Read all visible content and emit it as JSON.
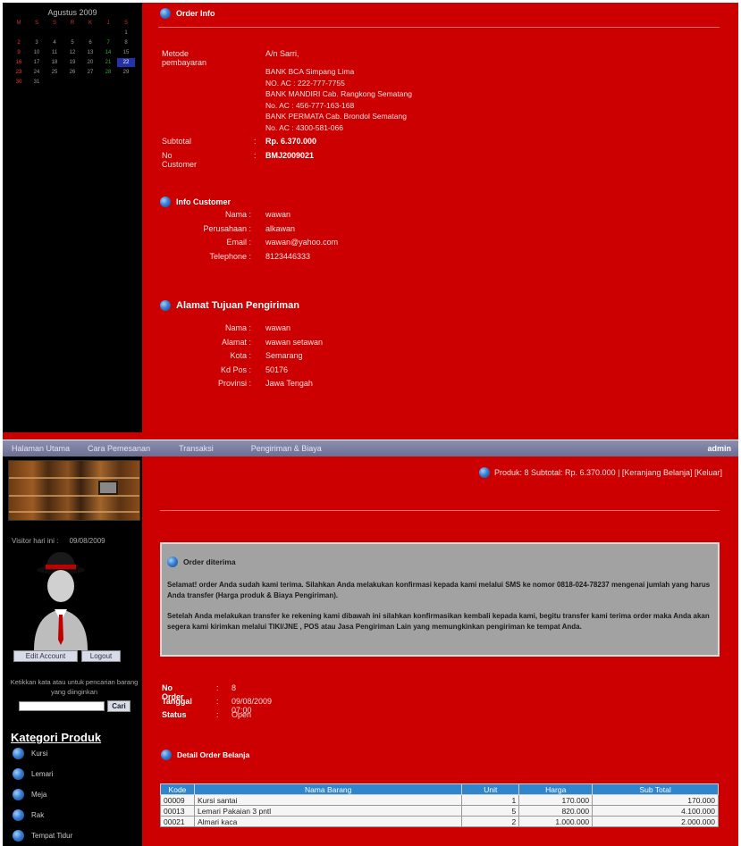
{
  "calendar": {
    "title": "Agustus 2009",
    "weekdays": [
      "M",
      "S",
      "S",
      "R",
      "K",
      "J",
      "S"
    ],
    "rows": [
      [
        "",
        "",
        "",
        "",
        "",
        "",
        "1"
      ],
      [
        "2",
        "3",
        "4",
        "5",
        "6",
        "7",
        "8"
      ],
      [
        "9",
        "10",
        "11",
        "12",
        "13",
        "14",
        "15"
      ],
      [
        "16",
        "17",
        "18",
        "19",
        "20",
        "21",
        "22"
      ],
      [
        "23",
        "24",
        "25",
        "26",
        "27",
        "28",
        "29"
      ],
      [
        "30",
        "31",
        "",
        "",
        "",
        "",
        ""
      ]
    ]
  },
  "order_info": {
    "title": "Order Info",
    "payment_label": "Metode pembayaran",
    "payment_to": "A/n Sarri,",
    "banks": [
      "BANK BCA Simpang Lima",
      "NO. AC : 222-777-7755",
      "BANK MANDIRI Cab. Rangkong Sematang",
      "No. AC : 456-777-163-168",
      "BANK PERMATA Cab. Brondol Sematang",
      "No. AC : 4300-581-066"
    ],
    "subtotal_label": "Subtotal",
    "subtotal_value": "Rp. 6.370.000",
    "customer_no_label": "No Customer",
    "customer_no_value": "BMJ2009021"
  },
  "customer_info": {
    "title": "Info Customer",
    "rows": [
      {
        "label": "Nama :",
        "value": "wawan"
      },
      {
        "label": "Perusahaan :",
        "value": "alkawan"
      },
      {
        "label": "Email :",
        "value": "wawan@yahoo.com"
      },
      {
        "label": "Telephone :",
        "value": "8123446333"
      }
    ]
  },
  "shipping_address": {
    "title": "Alamat Tujuan Pengiriman",
    "rows": [
      {
        "label": "Nama :",
        "value": "wawan"
      },
      {
        "label": "Alamat :",
        "value": "wawan setawan"
      },
      {
        "label": "Kota :",
        "value": "Semarang"
      },
      {
        "label": "Kd Pos :",
        "value": "50176"
      },
      {
        "label": "Provinsi :",
        "value": "Jawa Tengah"
      }
    ]
  },
  "nav": {
    "items": [
      "Halaman Utama",
      "Cara Pemesanan",
      "Transaksi",
      "Pengiriman & Biaya"
    ],
    "user": "admin"
  },
  "sidebar": {
    "visitor_label": "Visitor hari ini :",
    "visitor_value": "09/08/2009",
    "btn_edit": "Edit Account",
    "btn_logout": "Logout",
    "search_note": "Ketikkan kata atau untuk pencarian barang yang diinginkan",
    "search_button": "Cari",
    "category_title": "Kategori Produk",
    "categories": [
      "Kursi",
      "Lemari",
      "Meja",
      "Rak",
      "Tempat Tidur"
    ]
  },
  "cart": {
    "text": "Produk: 8 Subtotal: Rp. 6.370.000 | [Keranjang Belanja] [Keluar]"
  },
  "notice": {
    "title": "Order diterima",
    "p1": "Selamat! order Anda sudah kami terima. Silahkan Anda melakukan konfirmasi kepada kami melalui SMS ke nomor 0818-024-78237 mengenai jumlah yang harus Anda transfer (Harga produk & Biaya Pengiriman).",
    "p2": "Setelah Anda melakukan transfer ke rekening kami dibawah ini silahkan konfirmasikan kembali kepada kami, begitu transfer kami terima order maka Anda akan segera kami kirimkan melalui TIKI/JNE , POS atau Jasa Pengiriman Lain yang memungkinkan pengiriman ke tempat Anda."
  },
  "order": {
    "no_label": "No Order",
    "no_value": "8",
    "date_label": "Tanggal",
    "date_value": "09/08/2009 07:00",
    "status_label": "Status",
    "status_value": "Open"
  },
  "order_detail": {
    "title": "Detail Order Belanja",
    "columns": [
      "Kode",
      "Nama Barang",
      "Unit",
      "Harga",
      "Sub Total"
    ],
    "rows": [
      [
        "00009",
        "Kursi santai",
        "1",
        "170.000",
        "170.000"
      ],
      [
        "00013",
        "Lemari Pakaian 3 pntl",
        "5",
        "820.000",
        "4.100.000"
      ],
      [
        "00021",
        "Almari kaca",
        "2",
        "1.000.000",
        "2.000.000"
      ]
    ]
  }
}
